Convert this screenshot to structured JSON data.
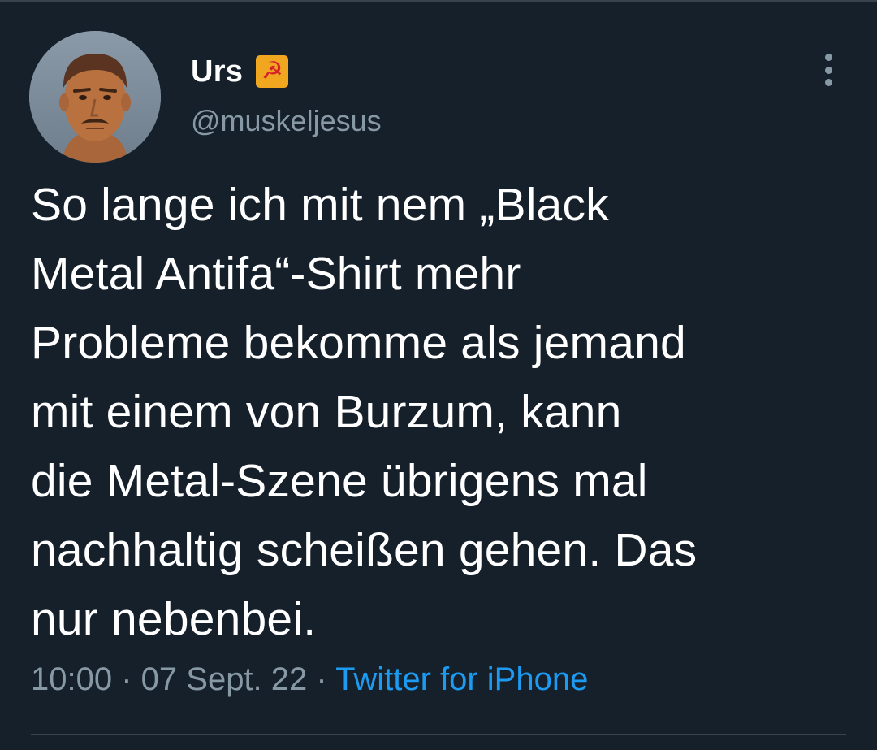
{
  "tweet": {
    "author": {
      "display_name": "Urs",
      "name_emoji": "☭",
      "handle": "@muskeljesus"
    },
    "text_lines": [
      "So lange ich mit nem „Black",
      "Metal Antifa“-Shirt mehr",
      "Probleme bekomme als jemand",
      "mit einem von Burzum, kann",
      "die Metal-Szene übrigens mal",
      "nachhaltig scheißen gehen. Das",
      "nur nebenbei."
    ],
    "time": "10:00",
    "separator": " · ",
    "date": "07 Sept. 22",
    "source": "Twitter for iPhone"
  },
  "colors": {
    "background": "#15202b",
    "text": "#ffffff",
    "secondary": "#8899a6",
    "link": "#1d9bf0",
    "divider": "#38444d"
  },
  "icons": {
    "more": "more-vertical-icon",
    "emoji": "hammer-and-sickle-icon"
  }
}
